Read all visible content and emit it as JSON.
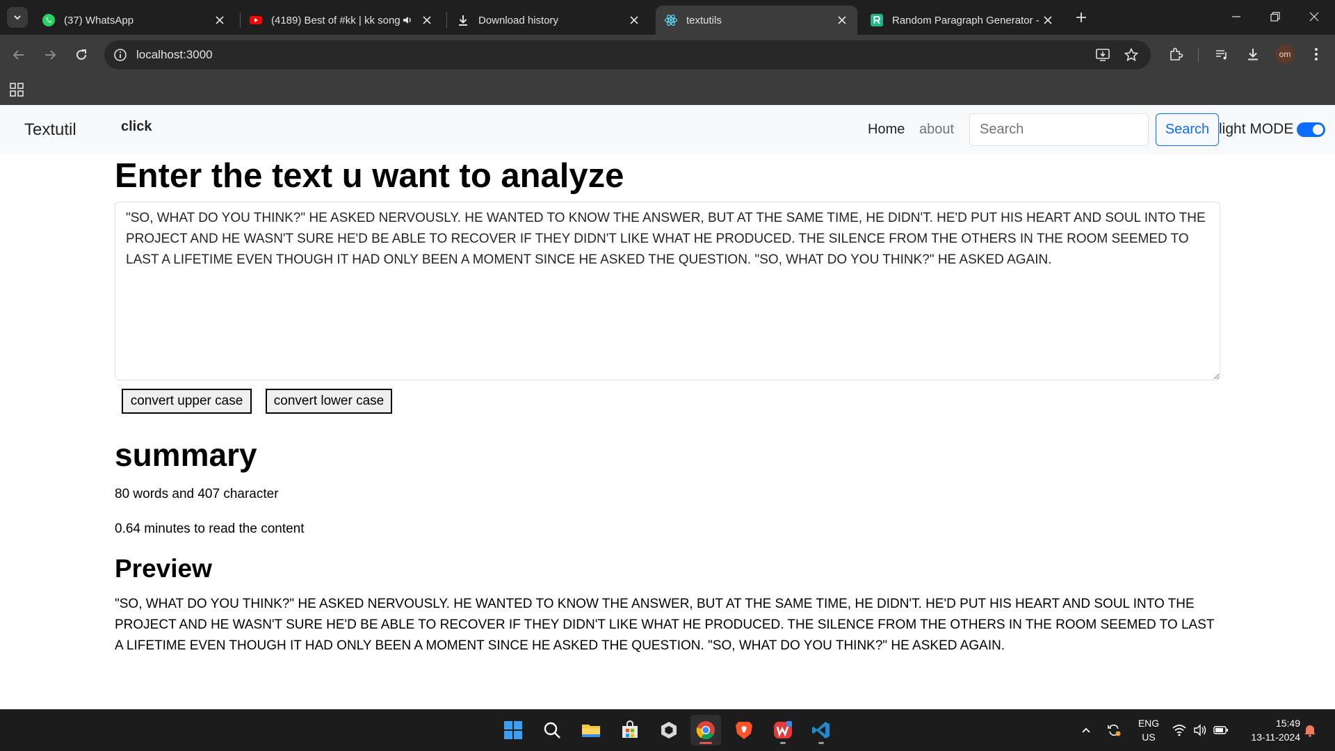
{
  "browser": {
    "tabs": [
      {
        "title": "(37) WhatsApp",
        "icon": "whatsapp-icon"
      },
      {
        "title": "(4189) Best of #kk | kk song",
        "icon": "youtube-icon"
      },
      {
        "title": "Download history",
        "icon": "download-icon"
      },
      {
        "title": "textutils",
        "icon": "react-icon",
        "active": true
      },
      {
        "title": "Random Paragraph Generator -",
        "icon": "r-logo-icon"
      }
    ],
    "url": "localhost:3000",
    "profile_initials": "om"
  },
  "navbar": {
    "brand": "Textutil",
    "extra_link": "click",
    "home": "Home",
    "about": "about",
    "search_placeholder": "Search",
    "search_button": "Search",
    "mode_label": "light MODE",
    "mode_enabled": true
  },
  "main": {
    "heading": "Enter the text u want to analyze",
    "text": "\"SO, WHAT DO YOU THINK?\" HE ASKED NERVOUSLY. HE WANTED TO KNOW THE ANSWER, BUT AT THE SAME TIME, HE DIDN'T. HE'D PUT HIS HEART AND SOUL INTO THE PROJECT AND HE WASN'T SURE HE'D BE ABLE TO RECOVER IF THEY DIDN'T LIKE WHAT HE PRODUCED. THE SILENCE FROM THE OTHERS IN THE ROOM SEEMED TO LAST A LIFETIME EVEN THOUGH IT HAD ONLY BEEN A MOMENT SINCE HE ASKED THE QUESTION. \"SO, WHAT DO YOU THINK?\" HE ASKED AGAIN.",
    "upper_button": "convert upper case",
    "lower_button": "convert lower case"
  },
  "summary": {
    "heading": "summary",
    "counts": "80 words and 407 character",
    "read_time": "0.64 minutes to read the content"
  },
  "preview": {
    "heading": "Preview"
  },
  "taskbar": {
    "apps": [
      "windows-start-icon",
      "search-icon",
      "file-explorer-icon",
      "microsoft-store-icon",
      "unity-icon",
      "chrome-icon",
      "brave-icon",
      "wps-office-icon",
      "vscode-icon"
    ],
    "language": "ENG",
    "region": "US",
    "time": "15:49",
    "date": "13-11-2024"
  },
  "colors": {
    "primary": "#0d6efd",
    "navbar_bg": "#f8f9fa",
    "chrome_dark": "#1f1f1f",
    "chrome_toolbar": "#3c3c3c",
    "taskbar": "#1c1c1c"
  }
}
